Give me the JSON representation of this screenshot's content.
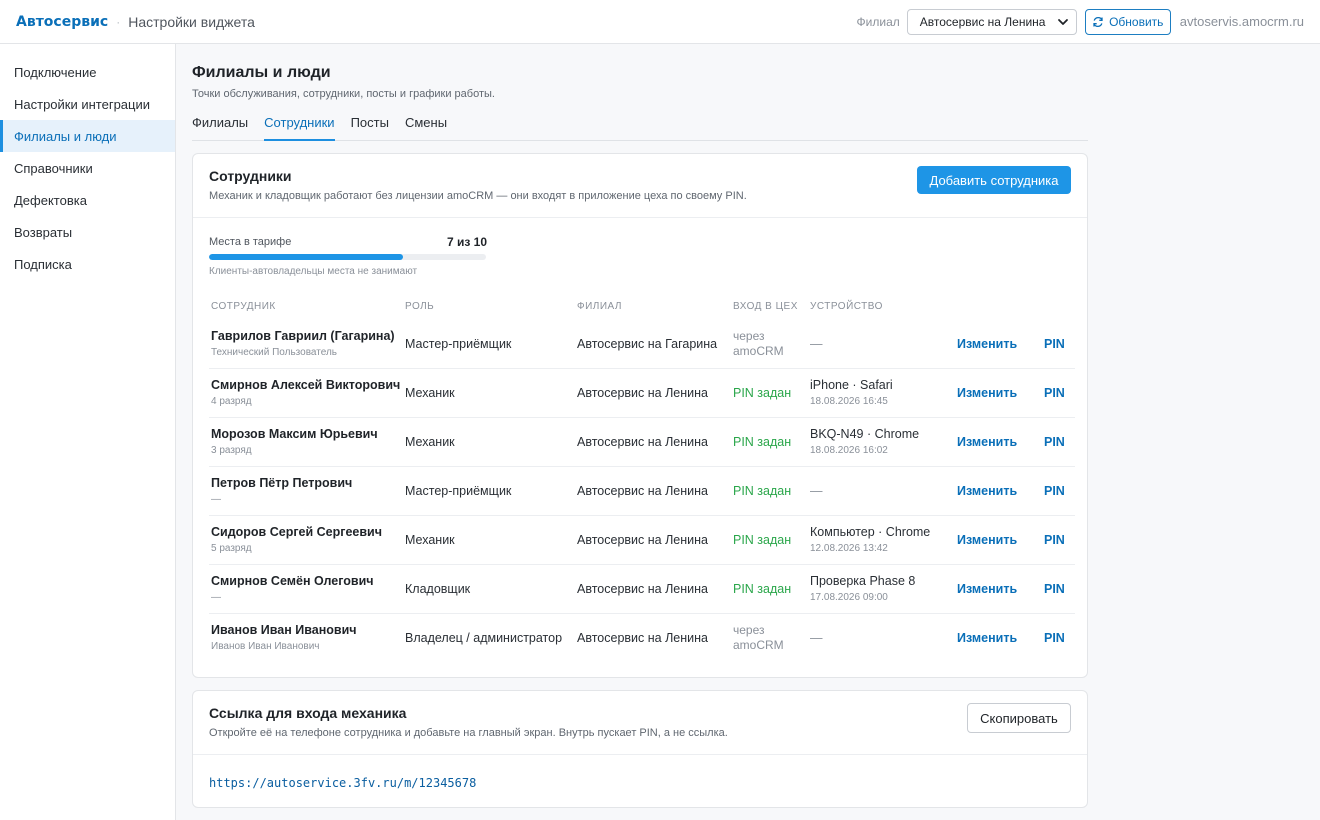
{
  "header": {
    "brand": "Автосервис",
    "separator": "·",
    "title": "Настройки виджета",
    "branch_label": "Филиал",
    "branch_selected": "Автосервис на Ленина",
    "refresh_label": "Обновить",
    "domain": "avtoservis.amocrm.ru",
    "icons": {
      "refresh": "refresh-icon",
      "dropdown": "chevron-down-icon"
    }
  },
  "sidebar": {
    "items": [
      {
        "label": "Подключение",
        "active": false
      },
      {
        "label": "Настройки интеграции",
        "active": false
      },
      {
        "label": "Филиалы и люди",
        "active": true
      },
      {
        "label": "Справочники",
        "active": false
      },
      {
        "label": "Дефектовка",
        "active": false
      },
      {
        "label": "Возвраты",
        "active": false
      },
      {
        "label": "Подписка",
        "active": false
      }
    ]
  },
  "page": {
    "title": "Филиалы и люди",
    "subtitle": "Точки обслуживания, сотрудники, посты и графики работы.",
    "tabs": [
      {
        "label": "Филиалы",
        "active": false
      },
      {
        "label": "Сотрудники",
        "active": true
      },
      {
        "label": "Посты",
        "active": false
      },
      {
        "label": "Смены",
        "active": false
      }
    ]
  },
  "employees": {
    "title": "Сотрудники",
    "description": "Механик и кладовщик работают без лицензии amoCRM — они входят в приложение цеха по своему PIN.",
    "add_button": "Добавить сотрудника",
    "quota": {
      "label": "Места в тарифе",
      "value_text": "7 из 10",
      "used": 7,
      "total": 10,
      "note": "Клиенты-автовладельцы места не занимают"
    },
    "columns": [
      "СОТРУДНИК",
      "РОЛЬ",
      "ФИЛИАЛ",
      "ВХОД В ЦЕХ",
      "УСТРОЙСТВО"
    ],
    "edit_label": "Изменить",
    "pin_label": "PIN",
    "rows": [
      {
        "name": "Гаврилов Гавриил (Гагарина)",
        "sub": "Технический Пользователь",
        "role": "Мастер-приёмщик",
        "branch": "Автосервис на Гагарина",
        "login": "через amoCRM",
        "login_type": "crm",
        "device": "—",
        "device_time": ""
      },
      {
        "name": "Смирнов Алексей Викторович",
        "sub": "4 разряд",
        "role": "Механик",
        "branch": "Автосервис на Ленина",
        "login": "PIN задан",
        "login_type": "pin",
        "device": "iPhone · Safari",
        "device_time": "18.08.2026 16:45"
      },
      {
        "name": "Морозов Максим Юрьевич",
        "sub": "3 разряд",
        "role": "Механик",
        "branch": "Автосервис на Ленина",
        "login": "PIN задан",
        "login_type": "pin",
        "device": "BKQ-N49 · Chrome",
        "device_time": "18.08.2026 16:02"
      },
      {
        "name": "Петров Пётр Петрович",
        "sub": "—",
        "role": "Мастер-приёмщик",
        "branch": "Автосервис на Ленина",
        "login": "PIN задан",
        "login_type": "pin",
        "device": "—",
        "device_time": ""
      },
      {
        "name": "Сидоров Сергей Сергеевич",
        "sub": "5 разряд",
        "role": "Механик",
        "branch": "Автосервис на Ленина",
        "login": "PIN задан",
        "login_type": "pin",
        "device": "Компьютер · Chrome",
        "device_time": "12.08.2026 13:42"
      },
      {
        "name": "Смирнов Семён Олегович",
        "sub": "—",
        "role": "Кладовщик",
        "branch": "Автосервис на Ленина",
        "login": "PIN задан",
        "login_type": "pin",
        "device": "Проверка Phase 8",
        "device_time": "17.08.2026 09:00"
      },
      {
        "name": "Иванов Иван Иванович",
        "sub": "Иванов Иван Иванович",
        "role": "Владелец / администратор",
        "branch": "Автосервис на Ленина",
        "login": "через amoCRM",
        "login_type": "crm",
        "device": "—",
        "device_time": ""
      }
    ]
  },
  "mechanic_link": {
    "title": "Ссылка для входа механика",
    "description": "Откройте её на телефоне сотрудника и добавьте на главный экран. Внутрь пускает PIN, а не ссылка.",
    "copy_button": "Скопировать",
    "url": "https://autoservice.3fv.ru/m/12345678"
  }
}
